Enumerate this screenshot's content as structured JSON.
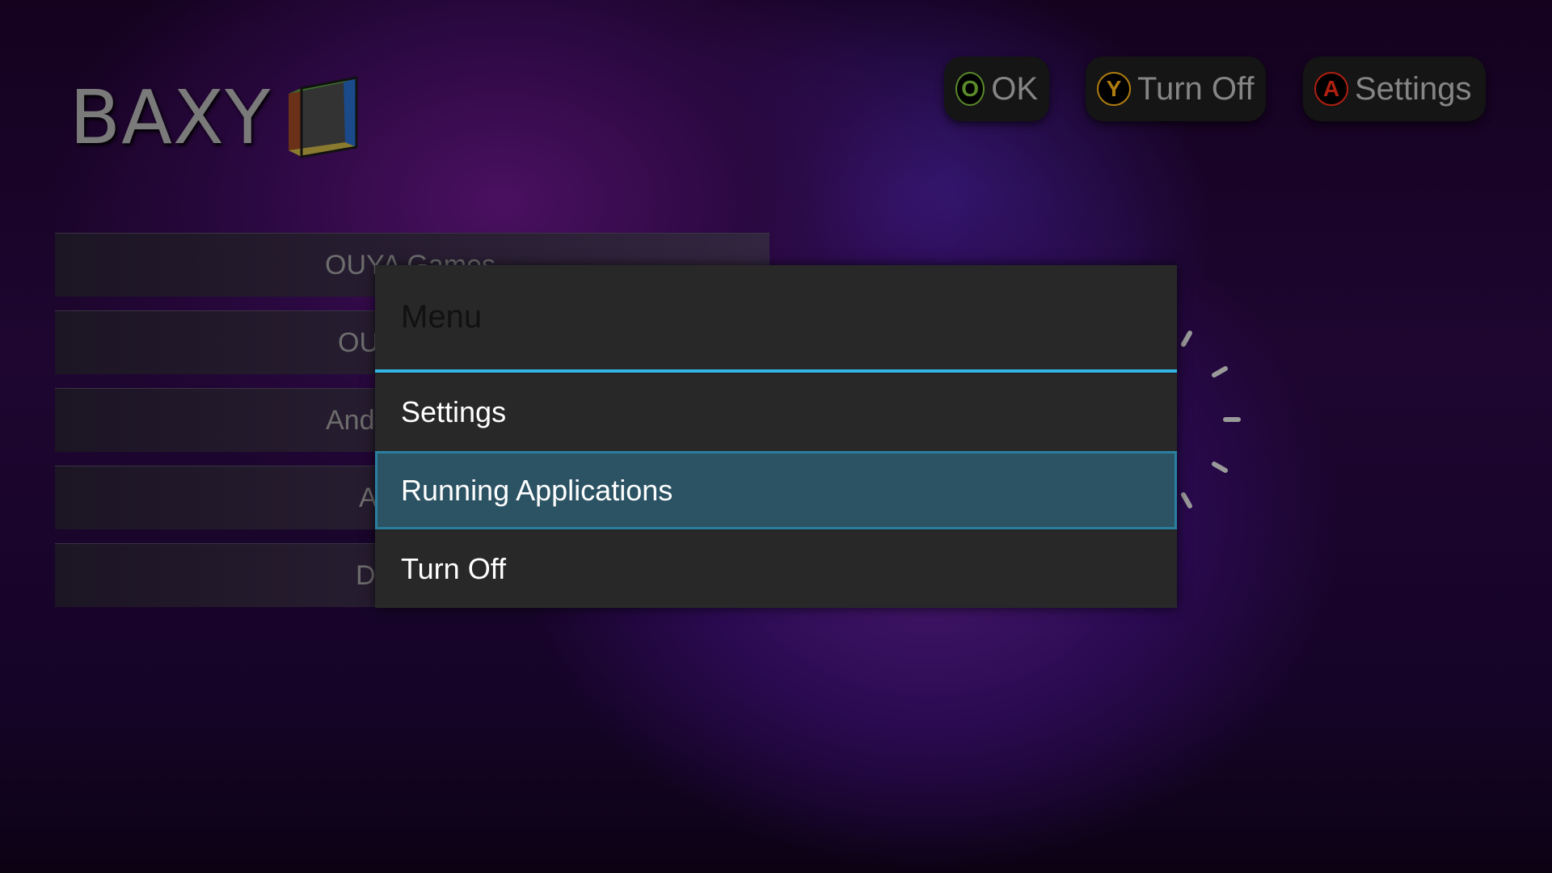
{
  "logo": {
    "text": "BAXY"
  },
  "header_buttons": [
    {
      "label": "OK",
      "glyph": "O",
      "color": "#5a8a2a",
      "icon": "o-button-icon"
    },
    {
      "label": "Turn Off",
      "glyph": "Y",
      "color": "#b07d10",
      "icon": "y-button-icon"
    },
    {
      "label": "Settings",
      "glyph": "A",
      "color": "#b02010",
      "icon": "a-button-icon"
    }
  ],
  "main_list": [
    {
      "label": "OUYA Games"
    },
    {
      "label": "OU"
    },
    {
      "label": "And"
    },
    {
      "label": "A"
    },
    {
      "label": "D"
    }
  ],
  "dialog": {
    "title": "Menu",
    "accent": "#33b5e5",
    "items": [
      {
        "label": "Settings"
      },
      {
        "label": "Running Applications",
        "selected": true
      },
      {
        "label": "Turn Off"
      }
    ]
  },
  "spinner": {
    "icon": "loading-spinner-icon"
  }
}
